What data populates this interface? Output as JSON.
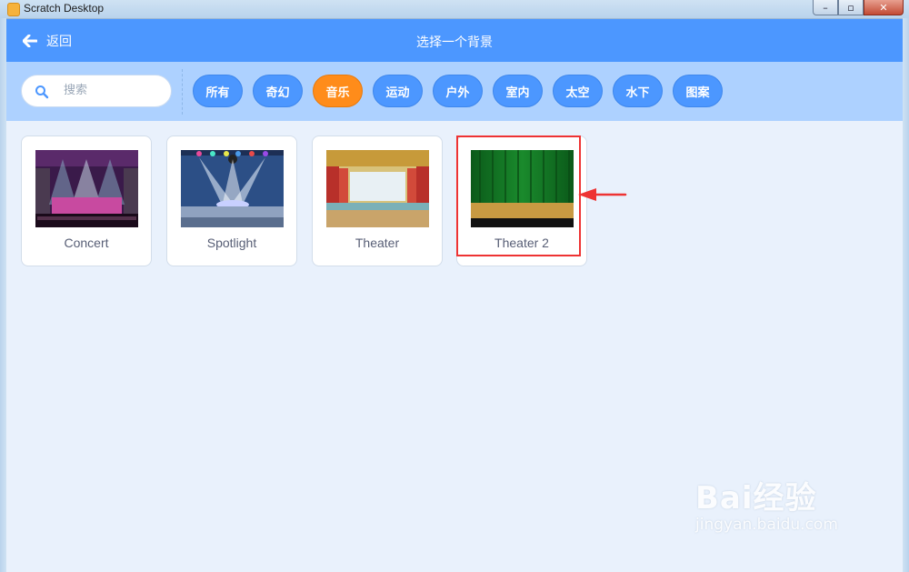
{
  "window": {
    "title": "Scratch Desktop"
  },
  "header": {
    "back_label": "返回",
    "title": "选择一个背景"
  },
  "search": {
    "placeholder": "搜索"
  },
  "tags": [
    {
      "label": "所有",
      "active": false
    },
    {
      "label": "奇幻",
      "active": false
    },
    {
      "label": "音乐",
      "active": true
    },
    {
      "label": "运动",
      "active": false
    },
    {
      "label": "户外",
      "active": false
    },
    {
      "label": "室内",
      "active": false
    },
    {
      "label": "太空",
      "active": false
    },
    {
      "label": "水下",
      "active": false
    },
    {
      "label": "图案",
      "active": false
    }
  ],
  "backdrops": [
    {
      "name": "Concert"
    },
    {
      "name": "Spotlight"
    },
    {
      "name": "Theater"
    },
    {
      "name": "Theater 2",
      "highlighted": true
    }
  ],
  "colors": {
    "header": "#4c97ff",
    "filterbar": "#add1ff",
    "active_tag": "#ff8c1a",
    "background": "#e9f1fc",
    "annotation": "#e33333"
  },
  "watermark": {
    "brand": "Bai经验",
    "url": "jingyan.baidu.com"
  }
}
